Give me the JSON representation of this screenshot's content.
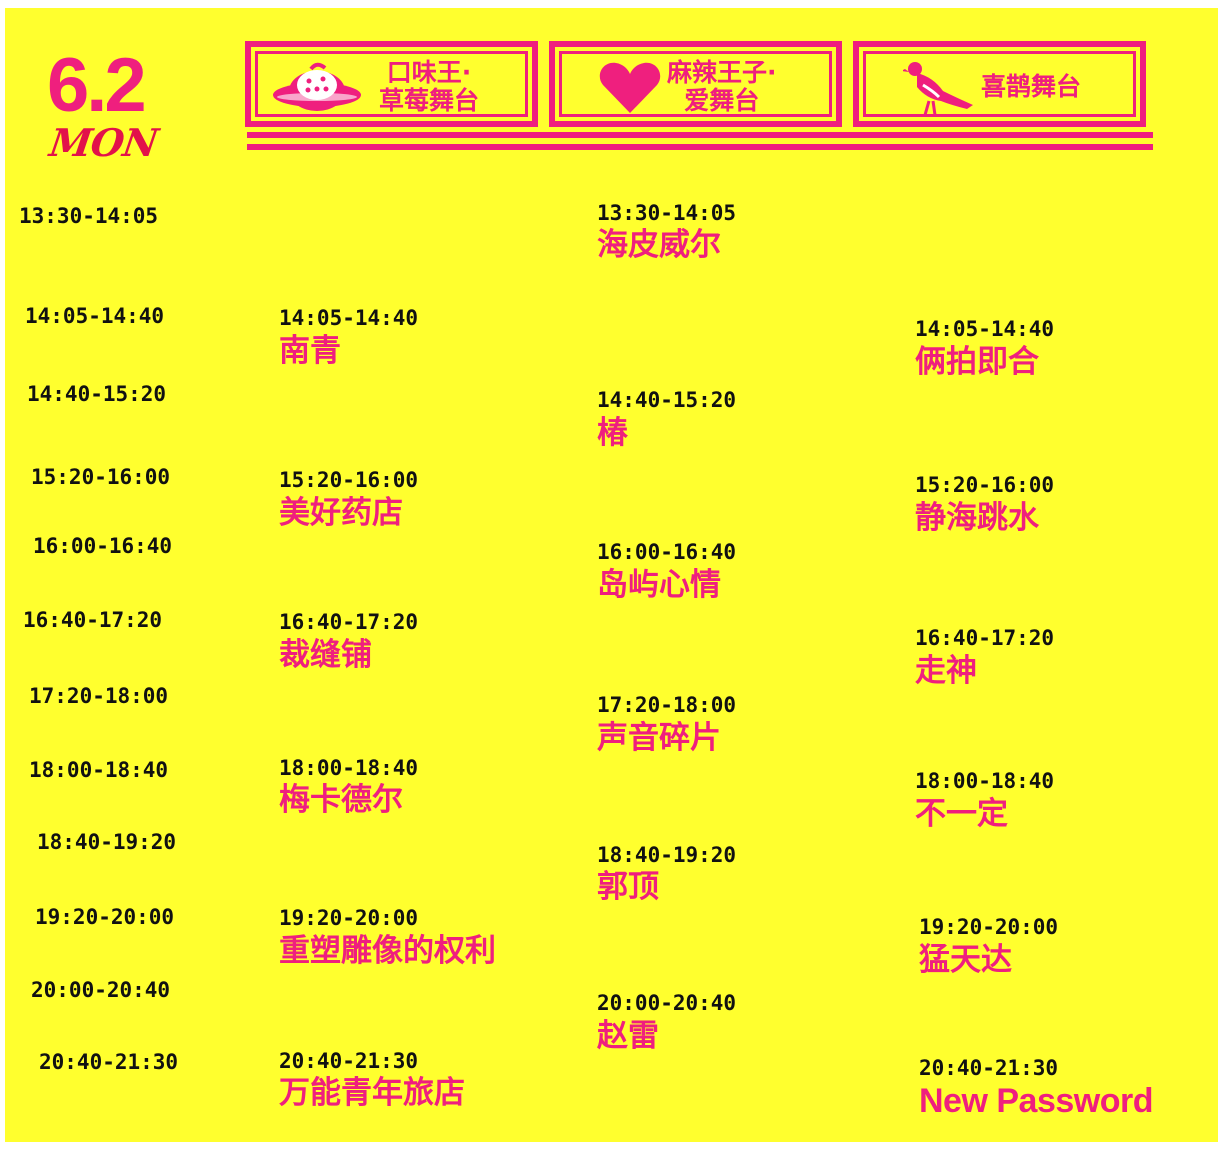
{
  "header": {
    "date": "6.2",
    "weekday": "MON"
  },
  "stages": [
    {
      "name_line1": "口味王·",
      "name_line2": "草莓舞台",
      "icon": "strawberry-saucer-icon"
    },
    {
      "name_line1": "麻辣王子·",
      "name_line2": "爱舞台",
      "icon": "heart-icon"
    },
    {
      "name_line1": "喜鹊舞台",
      "name_line2": "",
      "icon": "magpie-icon"
    }
  ],
  "timeline": [
    "13:30-14:05",
    "14:05-14:40",
    "14:40-15:20",
    "15:20-16:00",
    "16:00-16:40",
    "16:40-17:20",
    "17:20-18:00",
    "18:00-18:40",
    "18:40-19:20",
    "19:20-20:00",
    "20:00-20:40",
    "20:40-21:30"
  ],
  "strawberry_stage": [
    {
      "time": "14:05-14:40",
      "act": "南青"
    },
    {
      "time": "15:20-16:00",
      "act": "美好药店"
    },
    {
      "time": "16:40-17:20",
      "act": "裁缝铺"
    },
    {
      "time": "18:00-18:40",
      "act": "梅卡德尔"
    },
    {
      "time": "19:20-20:00",
      "act": "重塑雕像的权利"
    },
    {
      "time": "20:40-21:30",
      "act": "万能青年旅店"
    }
  ],
  "love_stage": [
    {
      "time": "13:30-14:05",
      "act": "海皮威尔"
    },
    {
      "time": "14:40-15:20",
      "act": "椿"
    },
    {
      "time": "16:00-16:40",
      "act": "岛屿心情"
    },
    {
      "time": "17:20-18:00",
      "act": "声音碎片"
    },
    {
      "time": "18:40-19:20",
      "act": "郭顶"
    },
    {
      "time": "20:00-20:40",
      "act": "赵雷"
    }
  ],
  "magpie_stage": [
    {
      "time": "14:05-14:40",
      "act": "俩拍即合"
    },
    {
      "time": "15:20-16:00",
      "act": "静海跳水"
    },
    {
      "time": "16:40-17:20",
      "act": "走神"
    },
    {
      "time": "18:00-18:40",
      "act": "不一定"
    },
    {
      "time": "19:20-20:00",
      "act": "猛天达"
    },
    {
      "time": "20:40-21:30",
      "act": "New Password"
    }
  ],
  "colors": {
    "background": "#ffff2e",
    "accent": "#ef1f7e",
    "text": "#111111"
  }
}
